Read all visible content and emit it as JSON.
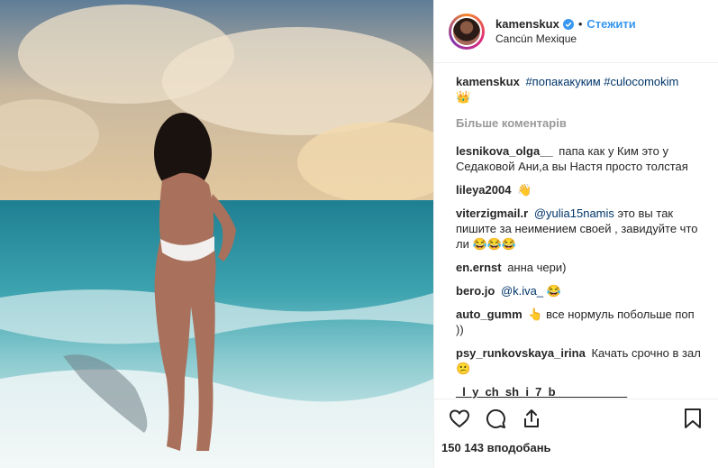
{
  "header": {
    "username": "kamenskux",
    "separator": "•",
    "follow_label": "Стежити",
    "location": "Cancún Mexique"
  },
  "caption": {
    "user": "kamenskux",
    "hashtag1": "#попакакуким",
    "hashtag2": "#culocomokim",
    "emoji": "👑"
  },
  "more_comments_label": "Більше коментарів",
  "comments": [
    {
      "user": "lesnikova_olga__",
      "text": "папа как у Ким это у Седаковой Ани,а вы Настя просто толстая"
    },
    {
      "user": "lileya2004",
      "text": "👋"
    },
    {
      "user": "viterzigmail.r",
      "mention": "@yulia15namis",
      "text": "это вы так пишите за неимением своей , завидуйте что ли 😂😂😂"
    },
    {
      "user": "en.ernst",
      "text": "анна чери)"
    },
    {
      "user": "bero.jo",
      "mention": "@k.iva_",
      "text": "😂"
    },
    {
      "user": "auto_gumm",
      "text": "👆 все нормуль побольше поп ))"
    },
    {
      "user": "psy_runkovskaya_irina",
      "text": "Качать срочно в зал 😕"
    },
    {
      "user": "_l_y_ch_sh_i_7_b___________",
      "text": ""
    }
  ],
  "likes": {
    "count": "150 143",
    "label": "вподобань"
  },
  "icons": {
    "like": "heart-icon",
    "comment": "comment-icon",
    "share": "share-icon",
    "save": "bookmark-icon",
    "verified": "verified-badge-icon"
  }
}
